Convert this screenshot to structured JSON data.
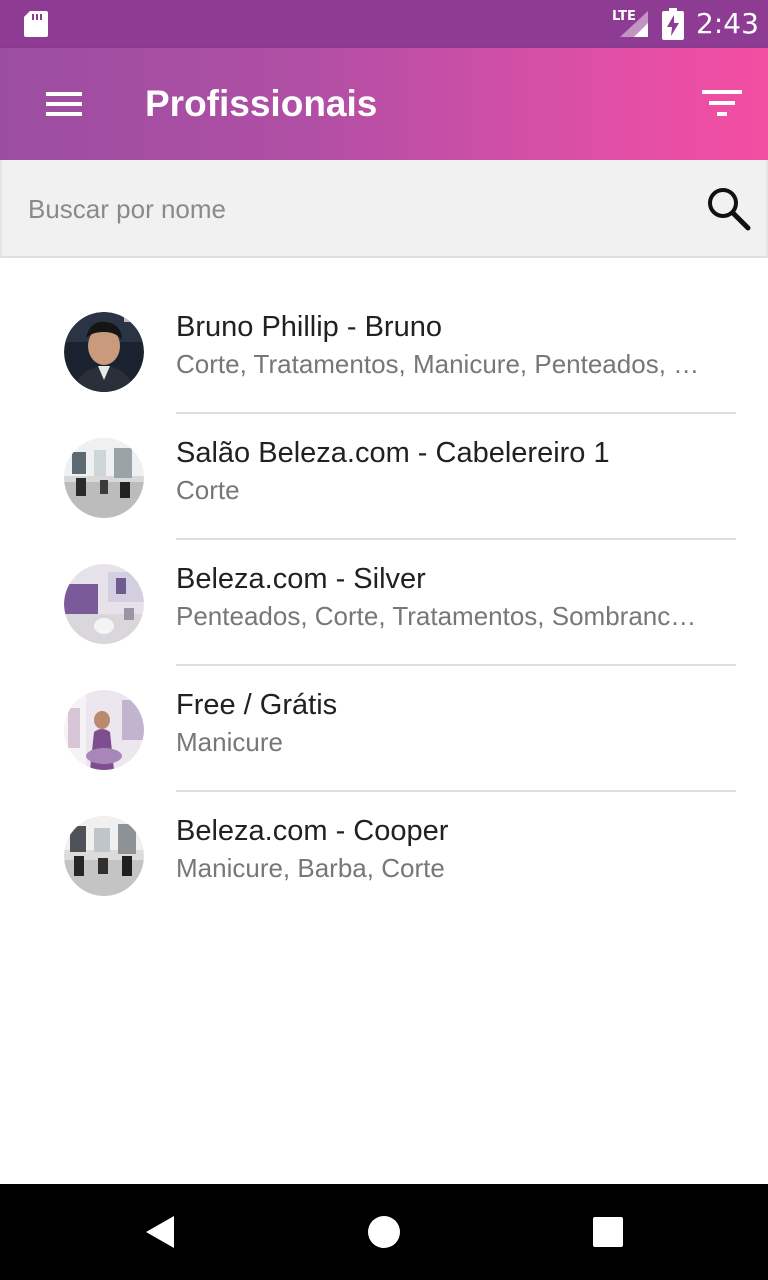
{
  "status_bar": {
    "network": "LTE",
    "time": "2:43",
    "icons": [
      "sd-card-icon",
      "lte-signal-icon",
      "battery-charging-icon"
    ]
  },
  "app_bar": {
    "title": "Profissionais",
    "icons": [
      "menu-icon",
      "filter-icon"
    ],
    "gradient_colors": [
      "#9b4ea0",
      "#f34ea2"
    ]
  },
  "search": {
    "placeholder": "Buscar por nome",
    "value": "",
    "icon": "search-icon"
  },
  "professionals": [
    {
      "name": "Bruno Phillip - Bruno",
      "services": "Corte, Tratamentos, Manicure, Penteados, Sombrancelha",
      "avatar": "portrait-photo"
    },
    {
      "name": "Salão Beleza.com - Cabelereiro 1",
      "services": "Corte",
      "avatar": "salon-photo"
    },
    {
      "name": "Beleza.com - Silver",
      "services": "Penteados, Corte, Tratamentos, Sombrancelha",
      "avatar": "salon-photo"
    },
    {
      "name": "Free / Grátis",
      "services": "Manicure",
      "avatar": "salon-photo"
    },
    {
      "name": "Beleza.com - Cooper",
      "services": "Manicure, Barba, Corte",
      "avatar": "salon-photo"
    }
  ],
  "nav_bar": {
    "icons": [
      "back-icon",
      "home-icon",
      "recents-icon"
    ]
  },
  "colors": {
    "status_bar": "#8e3c93",
    "primary_text": "#212121",
    "secondary_text": "#777777"
  }
}
